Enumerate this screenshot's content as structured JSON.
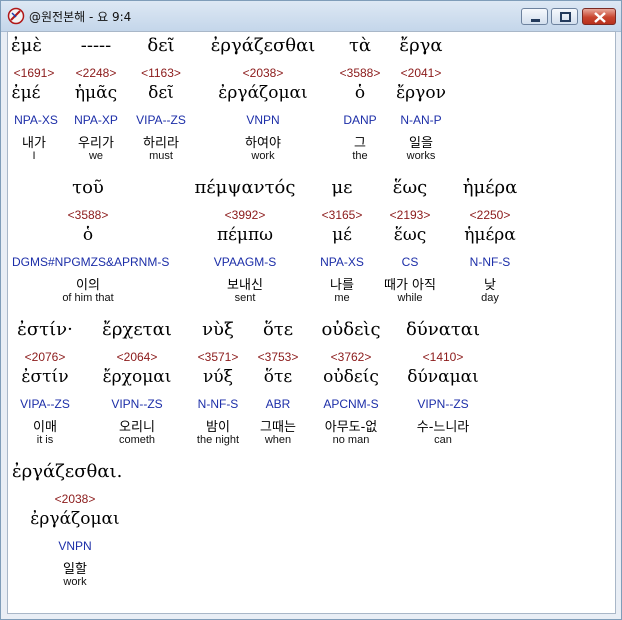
{
  "window": {
    "title": "@원전본해 - 요 9:4"
  },
  "rows": [
    {
      "words": [
        {
          "greek": "ἐμὲ",
          "strong": "<1691>",
          "lemma": "ἐμέ",
          "parse": "NPA-XS",
          "korean": "내가",
          "english": "I"
        },
        {
          "greek": "-----",
          "strong": "<2248>",
          "lemma": "ἡμᾶς",
          "parse": "NPA-XP",
          "korean": "우리가",
          "english": "we"
        },
        {
          "greek": "δεῖ",
          "strong": "<1163>",
          "lemma": "δεῖ",
          "parse": "VIPA--ZS",
          "korean": "하리라",
          "english": "must"
        },
        {
          "greek": "ἐργάζεσθαι",
          "strong": "<2038>",
          "lemma": "ἐργάζομαι",
          "parse": "VNPN",
          "korean": "하여야",
          "english": "work"
        },
        {
          "greek": "τὰ",
          "strong": "<3588>",
          "lemma": "ὁ",
          "parse": "DANP",
          "korean": "그",
          "english": "the"
        },
        {
          "greek": "ἔργα",
          "strong": "<2041>",
          "lemma": "ἔργον",
          "parse": "N-AN-P",
          "korean": "일을",
          "english": "works"
        }
      ]
    },
    {
      "words": [
        {
          "greek": "τοῦ",
          "strong": "<3588>",
          "lemma": "ὁ",
          "parse": "DGMS#NPGMZS&APRNM-S",
          "korean": "이의",
          "english": "of him that"
        },
        {
          "greek": "πέμψαντός",
          "strong": "<3992>",
          "lemma": "πέμπω",
          "parse": "VPAAGM-S",
          "korean": "보내신",
          "english": "sent"
        },
        {
          "greek": "με",
          "strong": "<3165>",
          "lemma": "μέ",
          "parse": "NPA-XS",
          "korean": "나를",
          "english": "me"
        },
        {
          "greek": "ἕως",
          "strong": "<2193>",
          "lemma": "ἕως",
          "parse": "CS",
          "korean": "때가 아직",
          "english": "while"
        },
        {
          "greek": "ἡμέρα",
          "strong": "<2250>",
          "lemma": "ἡμέρα",
          "parse": "N-NF-S",
          "korean": "낮",
          "english": "day"
        }
      ]
    },
    {
      "words": [
        {
          "greek": "ἐστίν·",
          "strong": "<2076>",
          "lemma": "ἐστίν",
          "parse": "VIPA--ZS",
          "korean": "이매",
          "english": "it is"
        },
        {
          "greek": "ἔρχεται",
          "strong": "<2064>",
          "lemma": "ἔρχομαι",
          "parse": "VIPN--ZS",
          "korean": "오리니",
          "english": "cometh"
        },
        {
          "greek": "νὺξ",
          "strong": "<3571>",
          "lemma": "νύξ",
          "parse": "N-NF-S",
          "korean": "밤이",
          "english": "the night"
        },
        {
          "greek": "ὅτε",
          "strong": "<3753>",
          "lemma": "ὅτε",
          "parse": "ABR",
          "korean": "그때는",
          "english": "when"
        },
        {
          "greek": "οὐδεὶς",
          "strong": "<3762>",
          "lemma": "οὐδείς",
          "parse": "APCNM-S",
          "korean": "아무도-없",
          "english": "no man"
        },
        {
          "greek": "δύναται",
          "strong": "<1410>",
          "lemma": "δύναμαι",
          "parse": "VIPN--ZS",
          "korean": "수-느니라",
          "english": "can"
        }
      ]
    },
    {
      "words": [
        {
          "greek": "ἐργάζεσθαι.",
          "strong": "<2038>",
          "lemma": "ἐργάζομαι",
          "parse": "VNPN",
          "korean": "일할",
          "english": "work"
        }
      ]
    }
  ]
}
